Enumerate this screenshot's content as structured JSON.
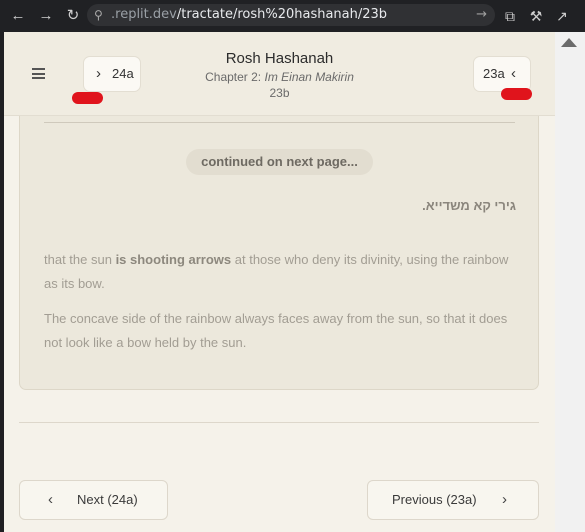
{
  "browser": {
    "url_host": ".replit.dev",
    "url_path": "/tractate/rosh%20hashanah/23b"
  },
  "header": {
    "menu_icon": "hamburger-icon",
    "next_label": "24a",
    "prev_label": "23a",
    "title": "Rosh Hashanah",
    "chapter_prefix": "Chapter 2:",
    "chapter_name": "Im Einan Makirin",
    "page": "23b"
  },
  "content": {
    "continued_label": "continued on next page...",
    "hebrew_text": "גירי קא משדייא.",
    "para1_before": "that the sun ",
    "para1_bold": "is shooting arrows",
    "para1_after": " at those who deny its divinity, using the rainbow as its bow.",
    "para2": "The concave side of the rainbow always faces away from the sun, so that it does not look like a bow held by the sun."
  },
  "footer": {
    "next_label": "Next (24a)",
    "prev_label": "Previous (23a)"
  },
  "colors": {
    "accent_marker": "#e0141c",
    "page_bg": "#f5f2ea",
    "card_bg": "#ece8dc"
  }
}
